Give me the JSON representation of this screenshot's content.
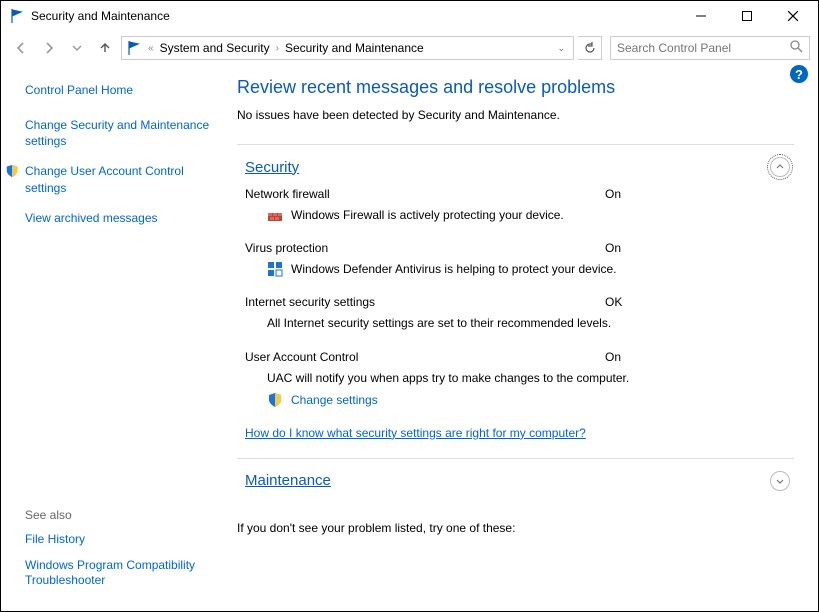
{
  "window": {
    "title": "Security and Maintenance",
    "minimize": "Minimize",
    "maximize": "Maximize",
    "close": "Close"
  },
  "nav": {
    "back": "Back",
    "forward": "Forward",
    "recent": "Recent",
    "up": "Up",
    "breadcrumb_root": "«",
    "crumb1": "System and Security",
    "crumb2": "Security and Maintenance",
    "refresh": "Refresh",
    "search_placeholder": "Search Control Panel"
  },
  "sidebar": {
    "home": "Control Panel Home",
    "links": [
      "Change Security and Maintenance settings",
      "Change User Account Control settings",
      "View archived messages"
    ],
    "see_also_hdr": "See also",
    "see_also": [
      "File History",
      "Windows Program Compatibility Troubleshooter"
    ]
  },
  "main": {
    "title": "Review recent messages and resolve problems",
    "subtitle": "No issues have been detected by Security and Maintenance.",
    "security": {
      "heading": "Security",
      "items": [
        {
          "label": "Network firewall",
          "status": "On",
          "desc": "Windows Firewall is actively protecting your device."
        },
        {
          "label": "Virus protection",
          "status": "On",
          "desc": "Windows Defender Antivirus is helping to protect your device."
        },
        {
          "label": "Internet security settings",
          "status": "OK",
          "desc": "All Internet security settings are set to their recommended levels."
        },
        {
          "label": "User Account Control",
          "status": "On",
          "desc": "UAC will notify you when apps try to make changes to the computer.",
          "link": "Change settings"
        }
      ],
      "help_link": "How do I know what security settings are right for my computer?"
    },
    "maintenance": {
      "heading": "Maintenance"
    },
    "footer": "If you don't see your problem listed, try one of these:"
  }
}
